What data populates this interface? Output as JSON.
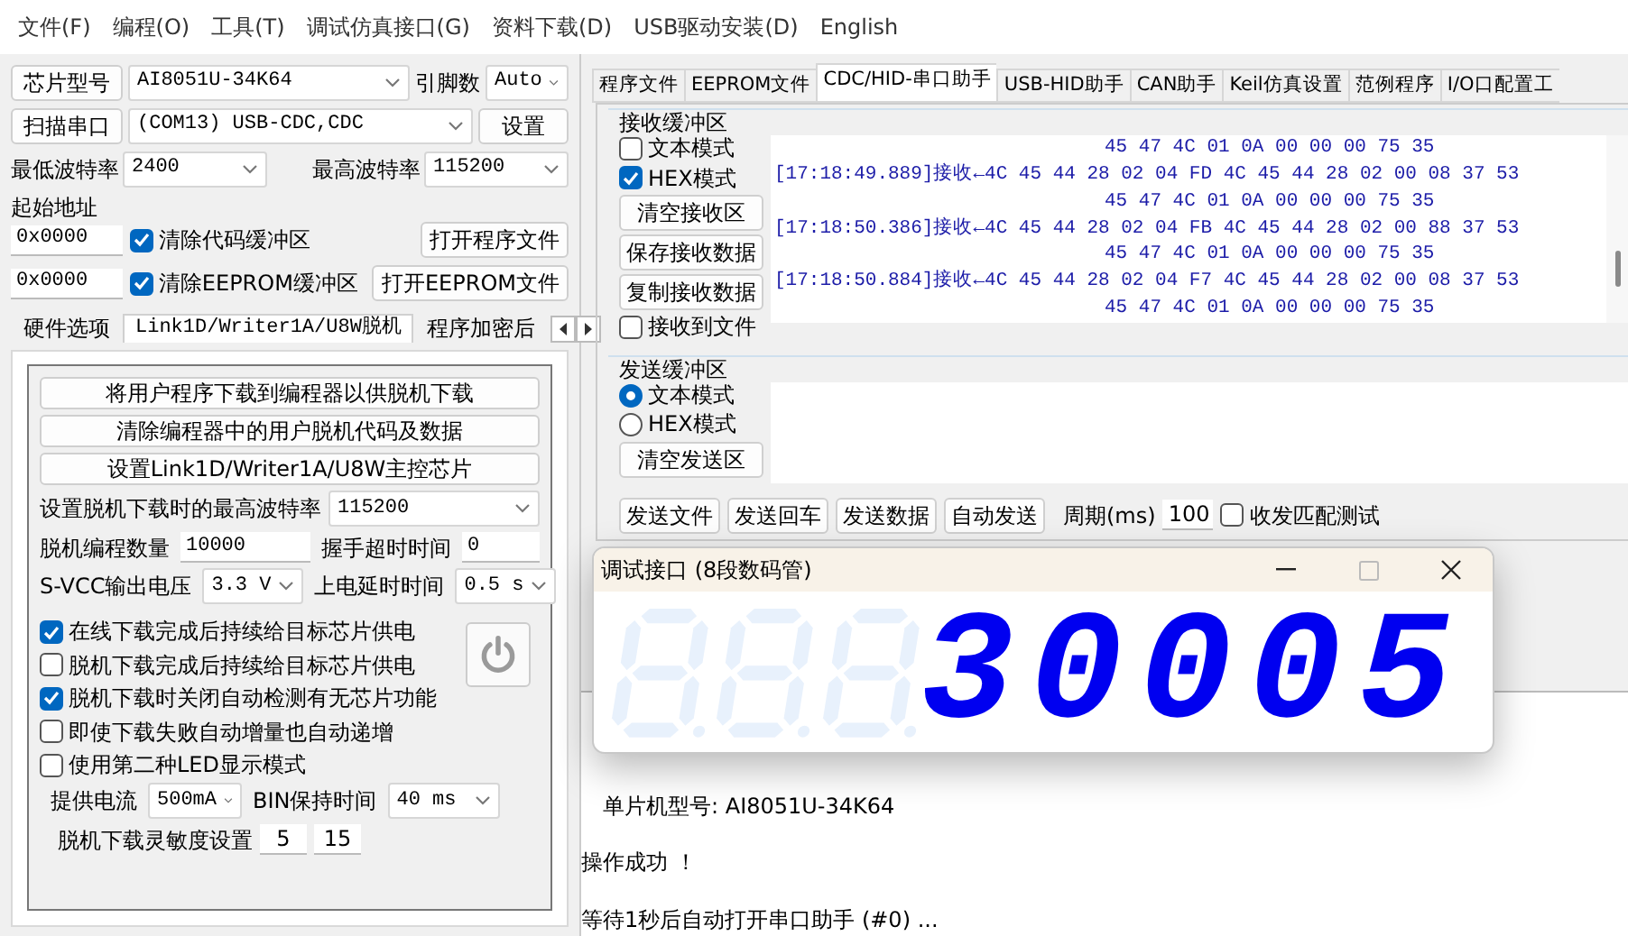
{
  "menu": [
    "文件(F)",
    "编程(O)",
    "工具(T)",
    "调试仿真接口(G)",
    "资料下载(D)",
    "USB驱动安装(D)",
    "English"
  ],
  "left_panel": {
    "chip_button": "芯片型号",
    "chip_model": "AI8051U-34K64",
    "pins_label": "引脚数",
    "pins": "Auto",
    "scan_button": "扫描串口",
    "port": "(COM13) USB-CDC,CDC",
    "settings_button": "设置",
    "min_baud_label": "最低波特率",
    "min_baud": "2400",
    "max_baud_label": "最高波特率",
    "max_baud": "115200",
    "start_address_label": "起始地址",
    "address_rows": [
      {
        "address": "0x0000",
        "checkbox": "清除代码缓冲区",
        "checked": true,
        "button": "打开程序文件"
      },
      {
        "address": "0x0000",
        "checkbox": "清除EEPROM缓冲区",
        "checked": true,
        "button": "打开EEPROM文件"
      }
    ],
    "tabs": [
      {
        "label": "硬件选项",
        "selected": false
      },
      {
        "label": "Link1D/Writer1A/U8W脱机",
        "selected": true
      },
      {
        "label": "程序加密后",
        "selected": false
      }
    ],
    "offline": {
      "buttons": [
        "将用户程序下载到编程器以供脱机下载",
        "清除编程器中的用户脱机代码及数据",
        "设置Link1D/Writer1A/U8W主控芯片"
      ],
      "baud": {
        "label": "设置脱机下载时的最高波特率",
        "value": "115200"
      },
      "pairs": [
        {
          "fields": [
            {
              "label": "脱机编程数量",
              "value": "10000",
              "kind": "input"
            },
            {
              "label": "握手超时时间",
              "value": "0",
              "kind": "input"
            }
          ]
        },
        {
          "fields": [
            {
              "label": "S-VCC输出电压",
              "value": "3.3 V",
              "kind": "select"
            },
            {
              "label": "上电延时时间",
              "value": "0.5 s",
              "kind": "select"
            }
          ]
        }
      ],
      "options": [
        {
          "label": "在线下载完成后持续给目标芯片供电",
          "checked": true
        },
        {
          "label": "脱机下载完成后持续给目标芯片供电",
          "checked": false
        },
        {
          "label": "脱机下载时关闭自动检测有无芯片功能",
          "checked": true
        },
        {
          "label": "即使下载失败自动增量也自动递增",
          "checked": false
        },
        {
          "label": "使用第二种LED显示模式",
          "checked": false
        }
      ],
      "bottom_pair": {
        "fields": [
          {
            "label": "提供电流",
            "value": "500mA",
            "kind": "select"
          },
          {
            "label": "BIN保持时间",
            "value": "40 ms",
            "kind": "select"
          }
        ]
      },
      "sensitivity": {
        "label": "脱机下载灵敏度设置",
        "values": [
          "5",
          "15"
        ]
      }
    }
  },
  "tabs": [
    {
      "label": "程序文件",
      "selected": false
    },
    {
      "label": "EEPROM文件",
      "selected": false
    },
    {
      "label": "CDC/HID-串口助手",
      "selected": true
    },
    {
      "label": "USB-HID助手",
      "selected": false
    },
    {
      "label": "CAN助手",
      "selected": false
    },
    {
      "label": "Keil仿真设置",
      "selected": false
    },
    {
      "label": "范例程序",
      "selected": false
    },
    {
      "label": "I/O口配置工",
      "selected": false
    }
  ],
  "receive": {
    "title": "接收缓冲区",
    "modes": [
      {
        "label": "文本模式",
        "checked": false
      },
      {
        "label": "HEX模式",
        "checked": true
      }
    ],
    "buttons": [
      "清空接收区",
      "保存接收数据",
      "复制接收数据"
    ],
    "to_file": {
      "label": "接收到文件",
      "checked": false
    },
    "lines": [
      {
        "kind": "continuation",
        "text": "45 47 4C 01 0A 00 00 00 75 35"
      },
      {
        "kind": "record",
        "text": "[17:18:49.889]接收←4C 45 44 28 02 04 FD 4C 45 44 28 02 00 08 37 53"
      },
      {
        "kind": "continuation",
        "text": "45 47 4C 01 0A 00 00 00 75 35"
      },
      {
        "kind": "record",
        "text": "[17:18:50.386]接收←4C 45 44 28 02 04 FB 4C 45 44 28 02 00 88 37 53"
      },
      {
        "kind": "continuation",
        "text": "45 47 4C 01 0A 00 00 00 75 35"
      },
      {
        "kind": "record",
        "text": "[17:18:50.884]接收←4C 45 44 28 02 04 F7 4C 45 44 28 02 00 08 37 53"
      },
      {
        "kind": "continuation",
        "text": "45 47 4C 01 0A 00 00 00 75 35"
      }
    ]
  },
  "send": {
    "title": "发送缓冲区",
    "modes": [
      {
        "label": "文本模式",
        "selected": true
      },
      {
        "label": "HEX模式",
        "selected": false
      }
    ],
    "clear_button": "清空发送区"
  },
  "send_bar": {
    "buttons": [
      "发送文件",
      "发送回车",
      "发送数据",
      "自动发送"
    ],
    "period_label": "周期(ms)",
    "period": "100",
    "match_test": {
      "label": "收发匹配测试",
      "checked": false
    }
  },
  "log": [
    {
      "text": "单片机型号: AI8051U-34K64",
      "indent": true
    },
    {
      "text": "操作成功 ！",
      "indent": false
    },
    {
      "text": "等待1秒后自动打开串口助手 (#0) ...",
      "indent": false
    }
  ],
  "display_window": {
    "title": "调试接口 (8段数码管)",
    "digits": [
      {
        "lit": false
      },
      {
        "lit": false
      },
      {
        "lit": false
      }
    ],
    "reading": "30005"
  }
}
